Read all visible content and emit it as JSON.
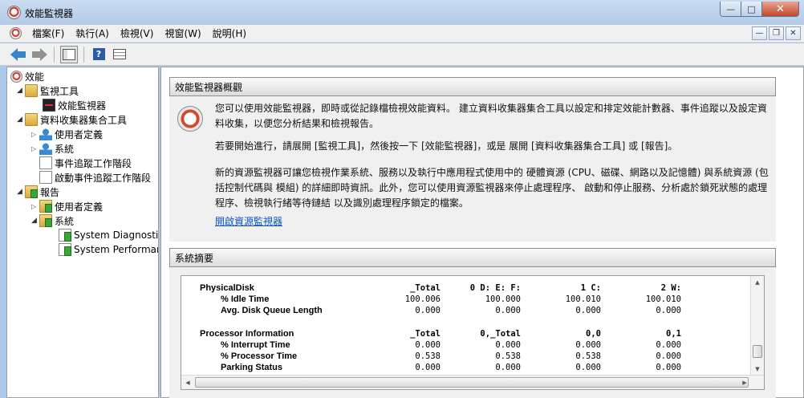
{
  "window": {
    "title": "效能監視器"
  },
  "menu": {
    "items": [
      "檔案(F)",
      "執行(A)",
      "檢視(V)",
      "視窗(W)",
      "說明(H)"
    ]
  },
  "tree": {
    "root": "效能",
    "items": [
      {
        "label": "監視工具"
      },
      {
        "label": "效能監視器"
      },
      {
        "label": "資料收集器集合工具"
      },
      {
        "label": "使用者定義"
      },
      {
        "label": "系統"
      },
      {
        "label": "事件追蹤工作階段"
      },
      {
        "label": "啟動事件追蹤工作階段"
      },
      {
        "label": "報告"
      },
      {
        "label": "使用者定義"
      },
      {
        "label": "系統"
      },
      {
        "label": "System Diagnostics"
      },
      {
        "label": "System Performance"
      }
    ]
  },
  "overview": {
    "header": "效能監視器概觀",
    "paragraph1": "您可以使用效能監視器，即時或從記錄檔檢視效能資料。 建立資料收集器集合工具以設定和排定效能計數器、事件追蹤以及設定資料收集，以便您分析結果和檢視報告。",
    "paragraph2": "若要開始進行，請展開 [監視工具]，然後按一下 [效能監視器]，或是 展開 [資料收集器集合工具] 或 [報告]。",
    "paragraph3": "新的資源監視器可讓您檢視作業系統、服務以及執行中應用程式使用中的 硬體資源 (CPU、磁碟、網路以及記憶體) 與系統資源 (包括控制代碼與 模組) 的詳細即時資訊。此外，您可以使用資源監視器來停止處理程序、 啟動和停止服務、分析處於鎖死狀態的處理程序、檢視執行緒等待鏈結 以及識別處理程序鎖定的檔案。",
    "link": "開啟資源監視器"
  },
  "summary": {
    "header": "系統摘要",
    "groups": [
      {
        "name": "PhysicalDisk",
        "columns": [
          "_Total",
          "0 D: E: F:",
          "1 C:",
          "2 W:"
        ],
        "rows": [
          {
            "label": "% Idle Time",
            "values": [
              "100.006",
              "100.000",
              "100.010",
              "100.010"
            ]
          },
          {
            "label": "Avg. Disk Queue Length",
            "values": [
              "0.000",
              "0.000",
              "0.000",
              "0.000"
            ]
          }
        ]
      },
      {
        "name": "Processor Information",
        "columns": [
          "_Total",
          "0,_Total",
          "0,0",
          "0,1"
        ],
        "rows": [
          {
            "label": "% Interrupt Time",
            "values": [
              "0.000",
              "0.000",
              "0.000",
              "0.000"
            ]
          },
          {
            "label": "% Processor Time",
            "values": [
              "0.538",
              "0.538",
              "0.538",
              "0.000"
            ]
          },
          {
            "label": "Parking Status",
            "values": [
              "0.000",
              "0.000",
              "0.000",
              "0.000"
            ]
          }
        ]
      }
    ]
  }
}
